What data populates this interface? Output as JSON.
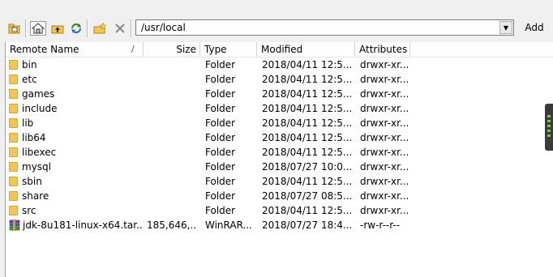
{
  "toolbar": {
    "buttons": [
      {
        "name": "up-folder-icon"
      },
      {
        "name": "home-icon"
      },
      {
        "name": "parent-folder-icon"
      },
      {
        "name": "refresh-icon"
      },
      {
        "name": "new-folder-icon"
      },
      {
        "name": "delete-icon"
      }
    ],
    "path_value": "/usr/local",
    "add_label": "Add"
  },
  "columns": {
    "name": "Remote Name",
    "size": "Size",
    "type": "Type",
    "modified": "Modified",
    "attributes": "Attributes",
    "sort_indicator": "/"
  },
  "files": [
    {
      "name": "bin",
      "size": "",
      "type": "Folder",
      "modified": "2018/04/11 12:5...",
      "attributes": "drwxr-xr...",
      "icon": "folder-icon"
    },
    {
      "name": "etc",
      "size": "",
      "type": "Folder",
      "modified": "2018/04/11 12:5...",
      "attributes": "drwxr-xr...",
      "icon": "folder-icon"
    },
    {
      "name": "games",
      "size": "",
      "type": "Folder",
      "modified": "2018/04/11 12:5...",
      "attributes": "drwxr-xr...",
      "icon": "folder-icon"
    },
    {
      "name": "include",
      "size": "",
      "type": "Folder",
      "modified": "2018/04/11 12:5...",
      "attributes": "drwxr-xr...",
      "icon": "folder-icon"
    },
    {
      "name": "lib",
      "size": "",
      "type": "Folder",
      "modified": "2018/04/11 12:5...",
      "attributes": "drwxr-xr...",
      "icon": "folder-icon"
    },
    {
      "name": "lib64",
      "size": "",
      "type": "Folder",
      "modified": "2018/04/11 12:5...",
      "attributes": "drwxr-xr...",
      "icon": "folder-icon"
    },
    {
      "name": "libexec",
      "size": "",
      "type": "Folder",
      "modified": "2018/04/11 12:5...",
      "attributes": "drwxr-xr...",
      "icon": "folder-icon"
    },
    {
      "name": "mysql",
      "size": "",
      "type": "Folder",
      "modified": "2018/07/27 10:0...",
      "attributes": "drwxr-xr...",
      "icon": "folder-icon"
    },
    {
      "name": "sbin",
      "size": "",
      "type": "Folder",
      "modified": "2018/04/11 12:5...",
      "attributes": "drwxr-xr...",
      "icon": "folder-icon"
    },
    {
      "name": "share",
      "size": "",
      "type": "Folder",
      "modified": "2018/07/27 08:5...",
      "attributes": "drwxr-xr...",
      "icon": "folder-icon"
    },
    {
      "name": "src",
      "size": "",
      "type": "Folder",
      "modified": "2018/04/11 12:5...",
      "attributes": "drwxr-xr...",
      "icon": "folder-icon"
    },
    {
      "name": "jdk-8u181-linux-x64.tar....",
      "size": "185,646,...",
      "type": "WinRAR...",
      "modified": "2018/07/27 18:4...",
      "attributes": "-rw-r--r--",
      "icon": "archive-icon"
    }
  ],
  "colors": {
    "folder": "#f2c650",
    "accent_grip": "#7fbf5f"
  }
}
